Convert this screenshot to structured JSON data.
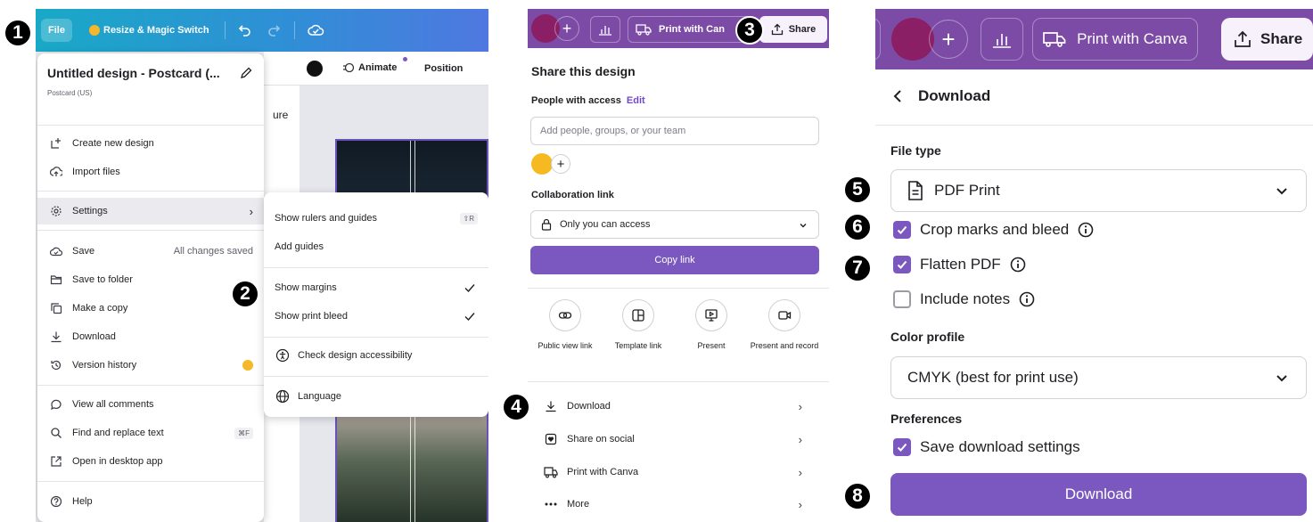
{
  "panel1": {
    "toolbar": {
      "file_label": "File",
      "resize_label": "Resize & Magic Switch",
      "animate_label": "Animate",
      "position_label": "Position",
      "side_fragment": "ure"
    },
    "file_menu": {
      "design_title": "Untitled design - Postcard (...",
      "design_subtitle": "Postcard (US)",
      "items": [
        {
          "label": "Create new design",
          "icon": "create-icon"
        },
        {
          "label": "Import files",
          "icon": "import-icon"
        },
        {
          "label": "Settings",
          "icon": "gear-icon",
          "has_submenu": true
        },
        {
          "label": "Save",
          "icon": "save-icon",
          "right_text": "All changes saved"
        },
        {
          "label": "Save to folder",
          "icon": "folder-icon"
        },
        {
          "label": "Make a copy",
          "icon": "copy-icon"
        },
        {
          "label": "Download",
          "icon": "download-icon"
        },
        {
          "label": "Version history",
          "icon": "history-icon",
          "badge": "crown"
        },
        {
          "label": "View all comments",
          "icon": "comment-icon"
        },
        {
          "label": "Find and replace text",
          "icon": "search-icon",
          "shortcut": "⌘F"
        },
        {
          "label": "Open in desktop app",
          "icon": "external-icon"
        },
        {
          "label": "Help",
          "icon": "help-icon"
        }
      ]
    },
    "settings_submenu": {
      "items": [
        {
          "label": "Show rulers and guides",
          "shortcut": "⇧R"
        },
        {
          "label": "Add guides"
        },
        {
          "label": "Show margins",
          "checked": true
        },
        {
          "label": "Show print bleed",
          "checked": true
        },
        {
          "label": "Check design accessibility",
          "icon": "accessibility-icon"
        },
        {
          "label": "Language",
          "icon": "globe-icon"
        }
      ]
    }
  },
  "panel2": {
    "toolbar": {
      "print_label": "Print with Can",
      "share_label": "Share"
    },
    "title": "Share this design",
    "people_label": "People with access",
    "edit_label": "Edit",
    "people_placeholder": "Add people, groups, or your team",
    "collab_label": "Collaboration link",
    "access_value": "Only you can access",
    "copy_link_label": "Copy link",
    "options": [
      {
        "label": "Public view link",
        "icon": "link-icon"
      },
      {
        "label": "Template link",
        "icon": "template-icon"
      },
      {
        "label": "Present",
        "icon": "present-icon"
      },
      {
        "label": "Present and record",
        "icon": "record-icon"
      }
    ],
    "rows": [
      {
        "label": "Download",
        "icon": "download-icon"
      },
      {
        "label": "Share on social",
        "icon": "heart-icon"
      },
      {
        "label": "Print with Canva",
        "icon": "truck-icon"
      },
      {
        "label": "More",
        "icon": "more-icon"
      }
    ]
  },
  "panel3": {
    "toolbar": {
      "print_label": "Print with Canva",
      "share_label": "Share"
    },
    "back_title": "Download",
    "file_type_label": "File type",
    "file_type_value": "PDF Print",
    "checkboxes": [
      {
        "label": "Crop marks and bleed",
        "checked": true
      },
      {
        "label": "Flatten PDF",
        "checked": true
      },
      {
        "label": "Include notes",
        "checked": false
      }
    ],
    "color_profile_label": "Color profile",
    "color_profile_value": "CMYK (best for print use)",
    "preferences_label": "Preferences",
    "save_settings_label": "Save download settings",
    "save_settings_checked": true,
    "download_label": "Download"
  },
  "steps": [
    "1",
    "2",
    "3",
    "4",
    "5",
    "6",
    "7",
    "8"
  ],
  "colors": {
    "canva_purple": "#7c4ba6",
    "button_purple": "#7a58bf",
    "toolbar_gradient_start": "#19a9c7",
    "toolbar_gradient_end": "#4f78e0"
  }
}
